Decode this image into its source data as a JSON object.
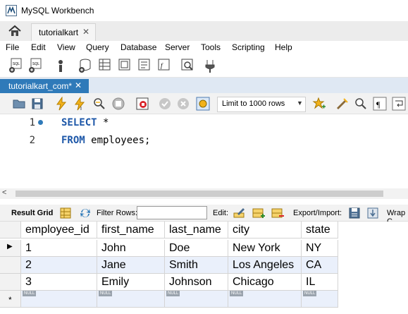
{
  "window": {
    "title": "MySQL Workbench"
  },
  "connection_tab": {
    "label": "tutorialkart",
    "close": "✕"
  },
  "menu": [
    "File",
    "Edit",
    "View",
    "Query",
    "Database",
    "Server",
    "Tools",
    "Scripting",
    "Help"
  ],
  "sql_tab": {
    "label": "tutorialkart_com*",
    "close": "✕"
  },
  "editor_toolbar": {
    "limit_label": "Limit to 1000 rows"
  },
  "editor": {
    "line_numbers": [
      "1",
      "2"
    ],
    "line1": {
      "keyword": "SELECT",
      "rest": " *"
    },
    "line2": {
      "keyword": "FROM",
      "rest": " employees;"
    }
  },
  "scrollbar": {
    "left_arrow": "<"
  },
  "result_toolbar": {
    "result_grid": "Result Grid",
    "filter_rows": "Filter Rows:",
    "filter_value": "",
    "edit": "Edit:",
    "export_import": "Export/Import:",
    "wrap": "Wrap C"
  },
  "grid": {
    "columns": [
      "employee_id",
      "first_name",
      "last_name",
      "city",
      "state"
    ],
    "rows": [
      [
        "1",
        "John",
        "Doe",
        "New York",
        "NY"
      ],
      [
        "2",
        "Jane",
        "Smith",
        "Los Angeles",
        "CA"
      ],
      [
        "3",
        "Emily",
        "Johnson",
        "Chicago",
        "IL"
      ]
    ],
    "null_label": "NULL",
    "current_row_marker": "▶",
    "new_row_marker": "*"
  }
}
